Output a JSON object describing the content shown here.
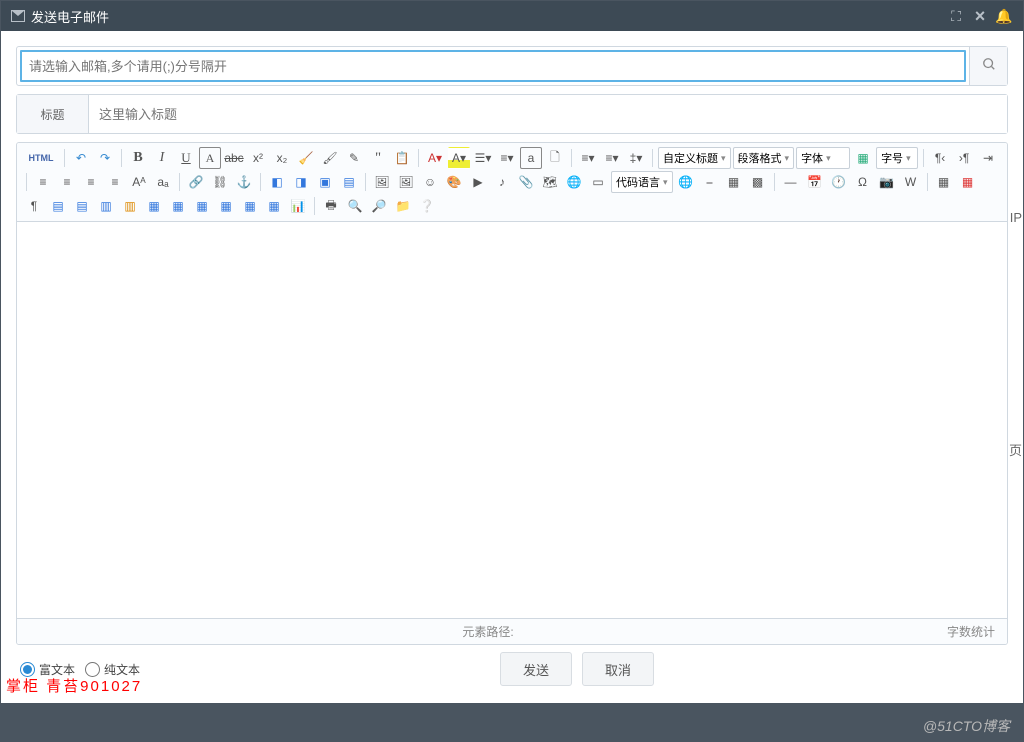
{
  "titlebar": {
    "title": "发送电子邮件"
  },
  "email": {
    "placeholder": "请选输入邮箱,多个请用(;)分号隔开"
  },
  "title": {
    "label": "标题",
    "placeholder": "这里输入标题"
  },
  "toolbar": {
    "html": "HTML",
    "custom_title": "自定义标题",
    "para_format": "段落格式",
    "font": "字体",
    "font_size": "字号",
    "code_lang": "代码语言"
  },
  "footer": {
    "element_path": "元素路径:",
    "char_count": "字数统计"
  },
  "format": {
    "opt1": "富文本",
    "opt2": "纯文本"
  },
  "buttons": {
    "send": "发送",
    "cancel": "取消"
  },
  "overlay": {
    "red_text": "掌柜   青苔901027"
  },
  "watermark": "@51CTO博客",
  "side": {
    "ip": "IP",
    "page": "页"
  }
}
